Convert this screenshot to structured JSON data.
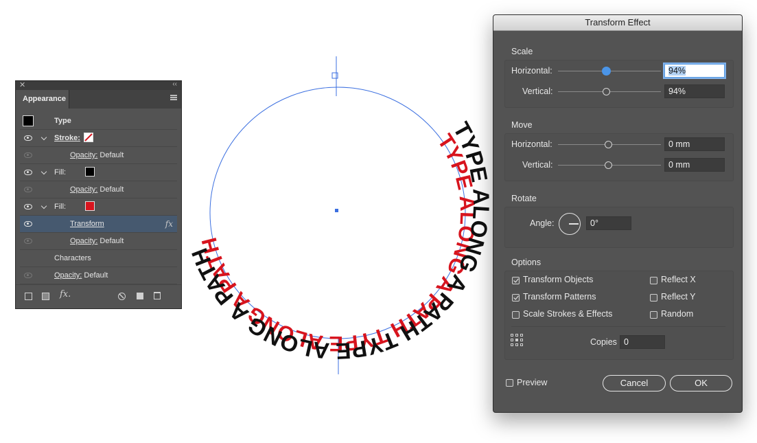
{
  "appearance": {
    "tab": "Appearance",
    "rows": [
      {
        "name": "Type"
      },
      {
        "name": "Stroke:"
      },
      {
        "name": "Opacity:",
        "value": "Default"
      },
      {
        "name": "Fill:"
      },
      {
        "name": "Opacity:",
        "value": "Default"
      },
      {
        "name": "Fill:"
      },
      {
        "name": "Transform"
      },
      {
        "name": "Opacity:",
        "value": "Default"
      },
      {
        "name": "Characters"
      },
      {
        "name": "Opacity:",
        "value": "Default"
      }
    ],
    "fx_label": "fx"
  },
  "artwork": {
    "text": "TYPE ALONG A PATH TYPE ALONG A PATH",
    "colors": {
      "front": "#111111",
      "back": "#d7141e",
      "path": "#3b6fe0"
    }
  },
  "dialog": {
    "title": "Transform Effect",
    "scale": {
      "title": "Scale",
      "h_label": "Horizontal:",
      "h_value": "94%",
      "v_label": "Vertical:",
      "v_value": "94%",
      "h_level": 0.94,
      "v_level": 0.94
    },
    "move": {
      "title": "Move",
      "h_label": "Horizontal:",
      "h_value": "0 mm",
      "v_label": "Vertical:",
      "v_value": "0 mm"
    },
    "rotate": {
      "title": "Rotate",
      "angle_label": "Angle:",
      "angle_value": "0°"
    },
    "options": {
      "title": "Options",
      "transform_objects": {
        "label": "Transform Objects",
        "checked": true
      },
      "transform_patterns": {
        "label": "Transform Patterns",
        "checked": true
      },
      "scale_strokes": {
        "label": "Scale Strokes & Effects",
        "checked": false
      },
      "reflect_x": {
        "label": "Reflect X",
        "checked": false
      },
      "reflect_y": {
        "label": "Reflect Y",
        "checked": false
      },
      "random": {
        "label": "Random",
        "checked": false
      },
      "copies_label": "Copies",
      "copies_value": "0"
    },
    "preview_label": "Preview",
    "cancel_label": "Cancel",
    "ok_label": "OK"
  }
}
